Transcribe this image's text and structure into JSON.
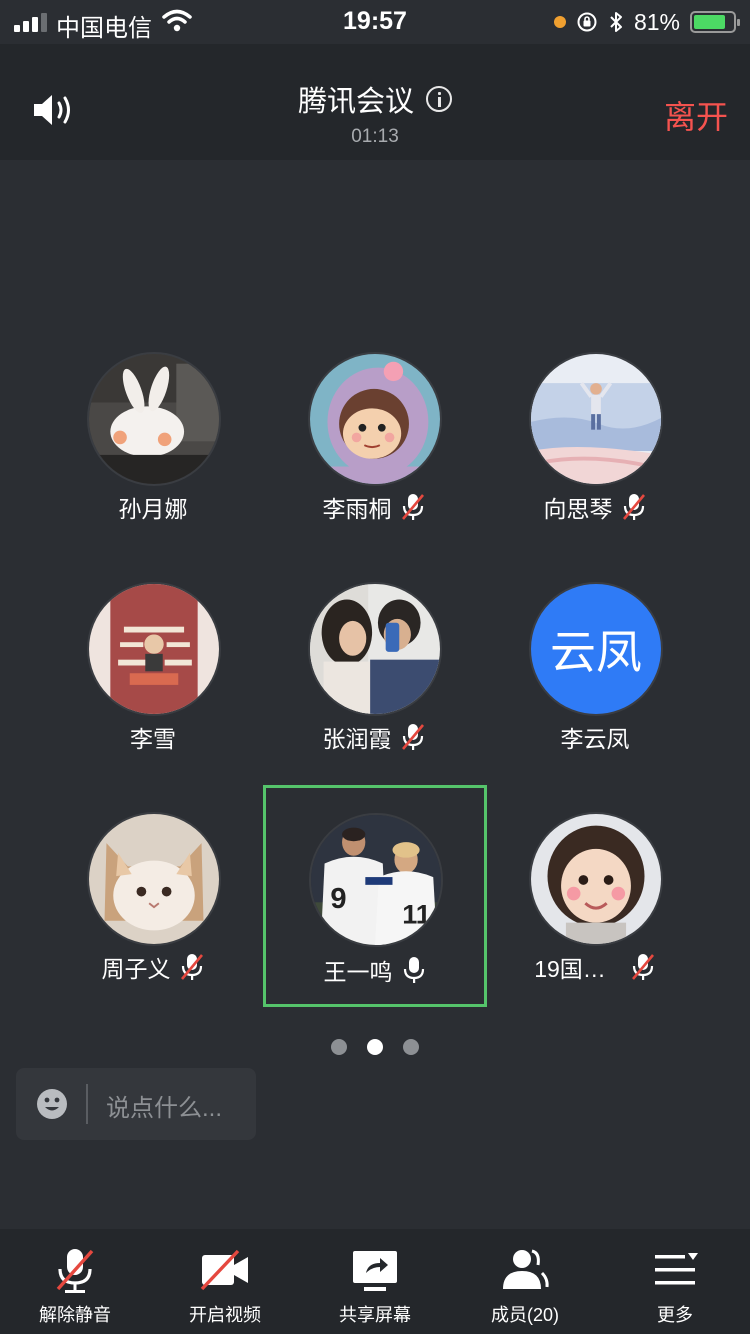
{
  "status_bar": {
    "carrier": "中国电信",
    "time": "19:57",
    "battery": "81%",
    "battery_level": 0.81
  },
  "header": {
    "title": "腾讯会议",
    "duration": "01:13",
    "leave_label": "离开"
  },
  "participants": [
    {
      "name": "孙月娜",
      "muted": null,
      "avatar": "rabbit-photo"
    },
    {
      "name": "李雨桐",
      "muted": true,
      "avatar": "cartoon-girl"
    },
    {
      "name": "向思琴",
      "muted": true,
      "avatar": "beach-person"
    },
    {
      "name": "李雪",
      "muted": null,
      "avatar": "poster-cartoon"
    },
    {
      "name": "张润霞",
      "muted": true,
      "avatar": "couple-photo"
    },
    {
      "name": "李云凤",
      "muted": null,
      "avatar_text": "云凤",
      "avatar_color": "#2f7bf6"
    },
    {
      "name": "周子义",
      "muted": true,
      "avatar": "cat-photo"
    },
    {
      "name": "王一鸣",
      "muted": false,
      "avatar": "football-players",
      "active": true
    },
    {
      "name": "19国…",
      "muted": true,
      "avatar": "child-photo"
    }
  ],
  "pager": {
    "pages": 3,
    "current": 2
  },
  "chat": {
    "placeholder": "说点什么..."
  },
  "toolbar": {
    "unmute_label": "解除静音",
    "video_label": "开启视频",
    "share_label": "共享屏幕",
    "members_label": "成员(20)",
    "more_label": "更多"
  },
  "colors": {
    "background": "#2b2e33",
    "header": "#24272b",
    "leave": "#f5534f",
    "active_border": "#55c46b",
    "muted_slash": "#e5483f"
  },
  "icons": [
    "signal-icon",
    "wifi-icon",
    "speaker-icon",
    "info-icon",
    "mic-muted-icon",
    "mic-icon",
    "emoji-icon",
    "video-off-icon",
    "share-screen-icon",
    "members-icon",
    "more-icon"
  ]
}
